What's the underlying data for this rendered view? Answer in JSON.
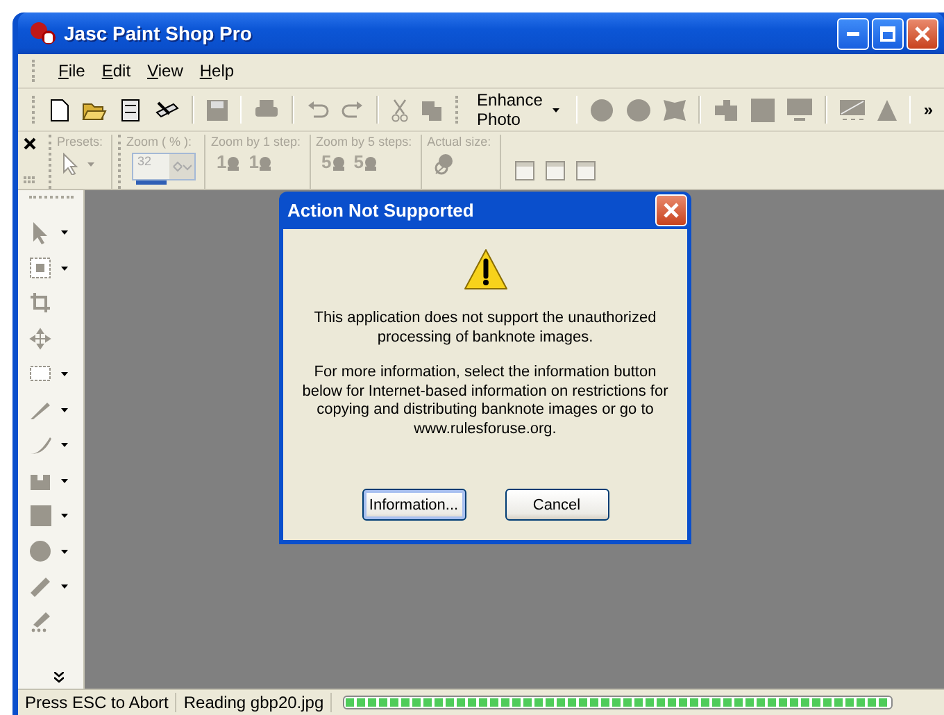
{
  "window": {
    "title": "Jasc Paint Shop Pro"
  },
  "menu": [
    {
      "label": "File"
    },
    {
      "label": "Edit"
    },
    {
      "label": "View"
    },
    {
      "label": "Help"
    }
  ],
  "toolbar": {
    "dropdown": "Enhance Photo",
    "overflow": "»"
  },
  "options": [
    {
      "label": "Presets:",
      "kind": "presets"
    },
    {
      "label": "Zoom ( % ):",
      "kind": "field",
      "value": "32",
      "disabled": true
    },
    {
      "label": "Zoom by 1 step:",
      "kind": "steps",
      "digits": [
        "1",
        "1"
      ]
    },
    {
      "label": "Zoom by 5 steps:",
      "kind": "steps",
      "digits": [
        "5",
        "5"
      ]
    },
    {
      "label": "Actual size:",
      "kind": "actual"
    }
  ],
  "dialog": {
    "title": "Action Not Supported",
    "paragraphs": [
      "This application does not support the unauthorized processing of banknote images.",
      "For more information, select the information button below for Internet-based information on restrictions for copying and distributing banknote images or go to www.rulesforuse.org."
    ],
    "buttons": [
      {
        "label": "Information...",
        "default": true
      },
      {
        "label": "Cancel",
        "default": false
      }
    ]
  },
  "status_bar": {
    "hint": "Press ESC to Abort",
    "file": "Reading gbp20.jpg",
    "level": 1
  }
}
